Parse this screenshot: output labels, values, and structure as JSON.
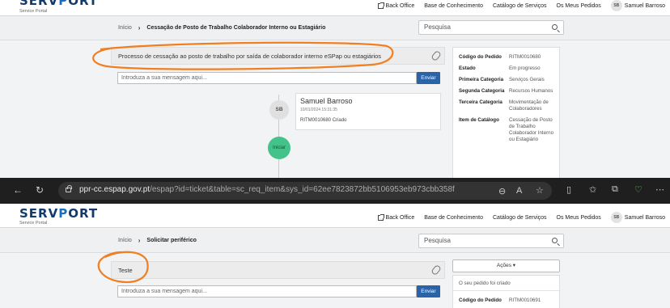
{
  "app": {
    "logo_main": "SERV",
    "logo_v": "P",
    "logo_rest": "ORT",
    "portal_label": "Service Portal"
  },
  "nav": {
    "back_office": "Back Office",
    "knowledge_base": "Base de Conhecimento",
    "service_catalog": "Catálogo de Serviços",
    "my_orders": "Os Meus Pedidos",
    "user_initials": "SB",
    "user_name": "Samuel Barroso"
  },
  "ticket1": {
    "breadcrumb_home": "Início",
    "breadcrumb_current": "Cessação de Posto de Trabalho Colaborador Interno ou Estagiário",
    "search_placeholder": "Pesquisa",
    "header_text": "Processo de cessação ao posto de trabalho por saída de colaborador interno eSPap ou estagiários",
    "message_placeholder": "Introduza a sua mensagem aqui...",
    "send_label": "Enviar",
    "activity": {
      "author": "Samuel Barroso",
      "initials": "SB",
      "date": "10/01/2024 15:31:35",
      "message": "RITM0010680 Criado"
    },
    "start_label": "Iniciar",
    "details": [
      {
        "key": "Código do Pedido",
        "value": "RITM0010680"
      },
      {
        "key": "Estado",
        "value": "Em progresso"
      },
      {
        "key": "Primeira Categoria",
        "value": "Serviços Gerais"
      },
      {
        "key": "Segunda Categoria",
        "value": "Recursos Humanos"
      },
      {
        "key": "Terceira Categoria",
        "value": "Movimentação de Colaboradores"
      },
      {
        "key": "Item de Catálogo",
        "value": "Cessação de Posto de Trabalho Colaborador Interno ou Estagiário"
      }
    ]
  },
  "browser": {
    "url_host": "ppr-cc.espap.gov.pt",
    "url_rest": "/espap?id=ticket&table=sc_req_item&sys_id=62ee7823872bb5106953eb973cbb358f"
  },
  "ticket2": {
    "breadcrumb_home": "Início",
    "breadcrumb_current": "Solicitar periférico",
    "search_placeholder": "Pesquisa",
    "header_text": "Teste",
    "message_placeholder": "Introduza a sua mensagem aqui...",
    "send_label": "Enviar",
    "actions_label": "Ações ▾",
    "created_message": "O seu pedido foi criado",
    "request_code_key": "Código do Pedido",
    "request_code_value": "RITM0010691"
  },
  "colors": {
    "annotation": "#f07f22",
    "primary": "#2a63a8",
    "start_green": "#43c28a",
    "brand_dark": "#123a6b"
  }
}
